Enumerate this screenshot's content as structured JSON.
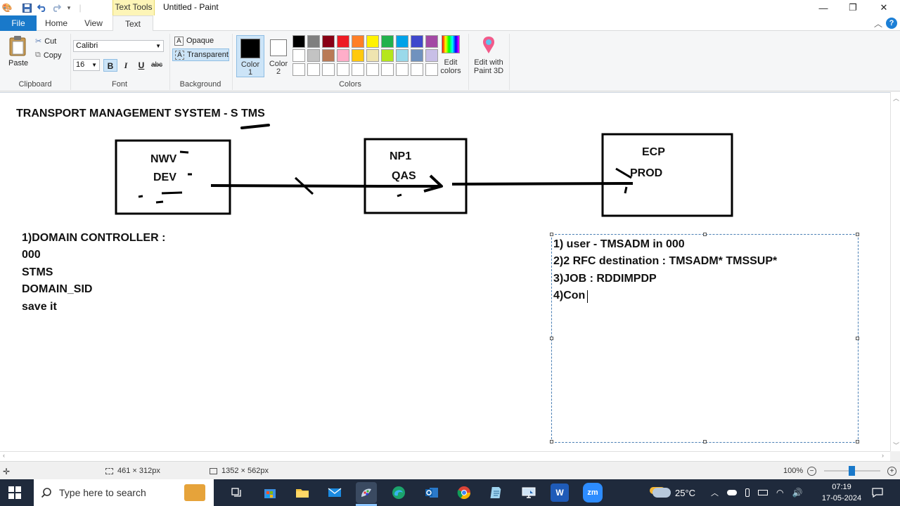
{
  "window": {
    "title": "Untitled - Paint",
    "context_tab": "Text Tools"
  },
  "tabs": {
    "file": "File",
    "home": "Home",
    "view": "View",
    "text": "Text"
  },
  "ribbon": {
    "clipboard": {
      "paste": "Paste",
      "cut": "Cut",
      "copy": "Copy",
      "label": "Clipboard"
    },
    "font": {
      "family": "Calibri",
      "size": "16",
      "bold": "B",
      "italic": "I",
      "underline": "U",
      "strike": "abc",
      "label": "Font"
    },
    "background": {
      "opaque": "Opaque",
      "transparent": "Transparent",
      "label": "Background"
    },
    "colors": {
      "color1": "Color 1",
      "color1_line1": "Color",
      "color1_line2": "1",
      "color2_line1": "Color",
      "color2_line2": "2",
      "edit_line1": "Edit",
      "edit_line2": "colors",
      "paint3d_line1": "Edit with",
      "paint3d_line2": "Paint 3D",
      "label": "Colors",
      "color1_value": "#000000",
      "color2_value": "#ffffff",
      "palette": [
        "#000000",
        "#7f7f7f",
        "#880015",
        "#ed1c24",
        "#ff7f27",
        "#fff200",
        "#22b14c",
        "#00a2e8",
        "#3f48cc",
        "#a349a4",
        "#ffffff",
        "#c3c3c3",
        "#b97a57",
        "#ffaec9",
        "#ffc90e",
        "#efe4b0",
        "#b5e61d",
        "#99d9ea",
        "#7092be",
        "#c8bfe7",
        "#ffffff",
        "#ffffff",
        "#ffffff",
        "#ffffff",
        "#ffffff",
        "#ffffff",
        "#ffffff",
        "#ffffff",
        "#ffffff",
        "#ffffff"
      ]
    }
  },
  "canvas": {
    "heading": "TRANSPORT MANAGEMENT SYSTEM - S TMS",
    "box1": {
      "line1": "NWV",
      "line2": "DEV"
    },
    "box2": {
      "line1": "NP1",
      "line2": "QAS"
    },
    "box3": {
      "line1": "ECP",
      "line2": "PROD"
    },
    "left_notes": [
      "1)DOMAIN CONTROLLER :",
      "000",
      "STMS",
      "DOMAIN_SID",
      "save it"
    ],
    "textbox_lines": [
      "1) user - TMSADM in 000",
      "2)2 RFC destination : TMSADM* TMSSUP*",
      "3)JOB : RDDIMPDP",
      "4)Con"
    ]
  },
  "status": {
    "selection_size": "461 × 312px",
    "image_size": "1352 × 562px",
    "zoom": "100%"
  },
  "taskbar": {
    "search_placeholder": "Type here to search",
    "weather": "25°C",
    "time": "07:19",
    "date": "17-05-2024",
    "zoom_app": "zm",
    "word_app": "W"
  }
}
